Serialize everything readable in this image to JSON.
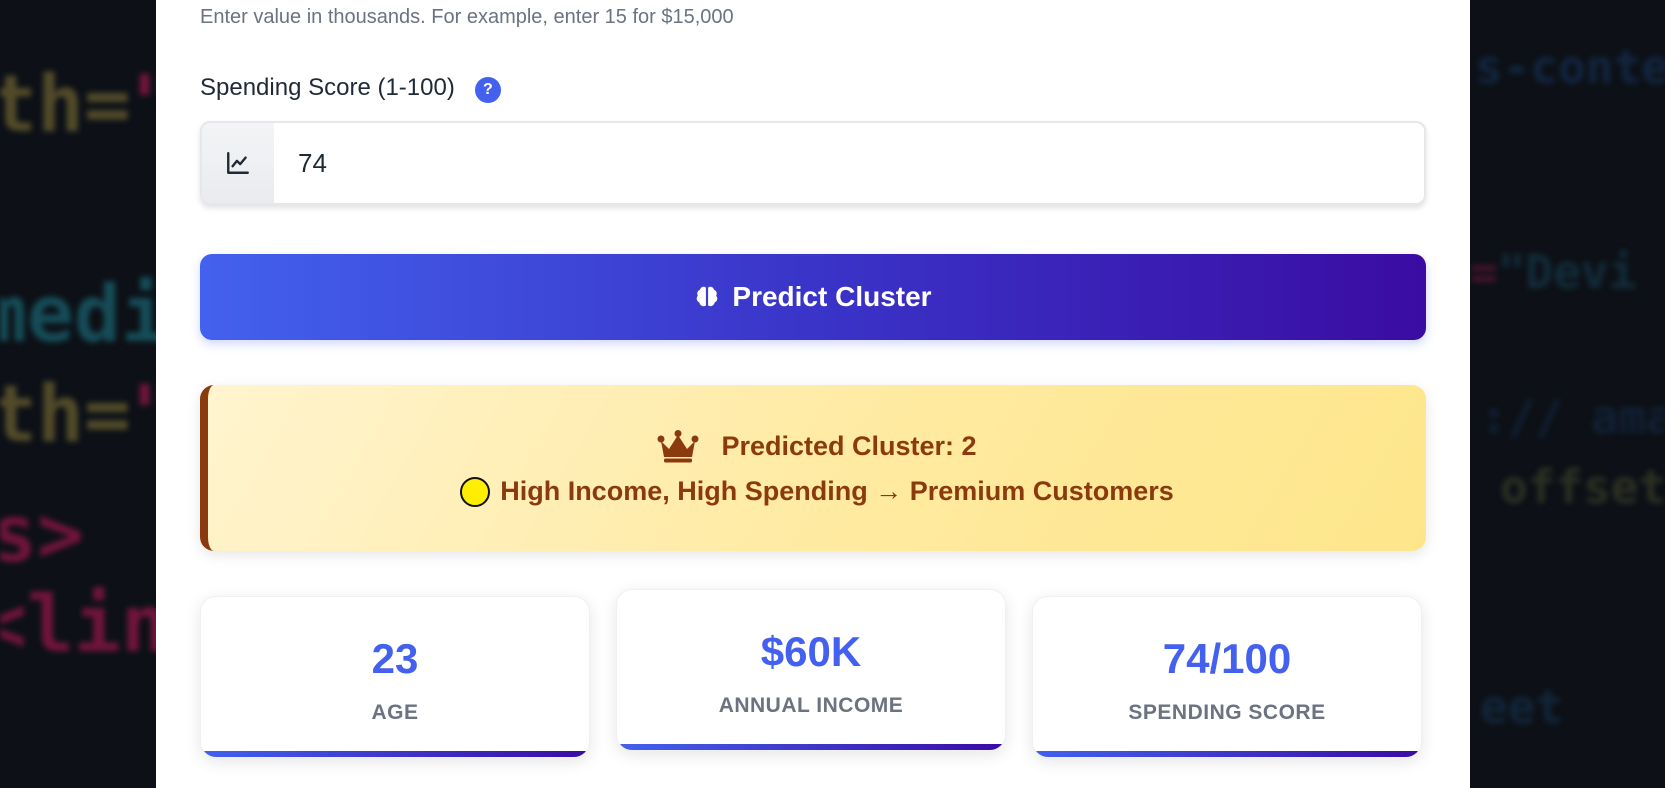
{
  "form": {
    "help_text": "Enter value in thousands. For example, enter 15 for $15,000",
    "spending_label": "Spending Score (1-100)",
    "help_badge": "?",
    "spending_value": "74",
    "input_icon": "chart-line-icon",
    "help_icon": "question-icon"
  },
  "predict_button": {
    "label": "Predict Cluster",
    "icon": "brain-icon"
  },
  "result": {
    "icon": "crown-icon",
    "cluster_text": "Predicted Cluster: 2",
    "segment_text": "High Income, High Spending → Premium Customers",
    "dot_icon": "yellow-circle-icon"
  },
  "stats": [
    {
      "value": "23",
      "label": "AGE"
    },
    {
      "value": "$60K",
      "label": "ANNUAL INCOME"
    },
    {
      "value": "74/100",
      "label": "SPENDING SCORE"
    }
  ],
  "colors": {
    "accent": "#4361ee",
    "accent_dark": "#3a0ca3",
    "result_text": "#8b3a0e",
    "result_bg": "#fff4cf"
  }
}
